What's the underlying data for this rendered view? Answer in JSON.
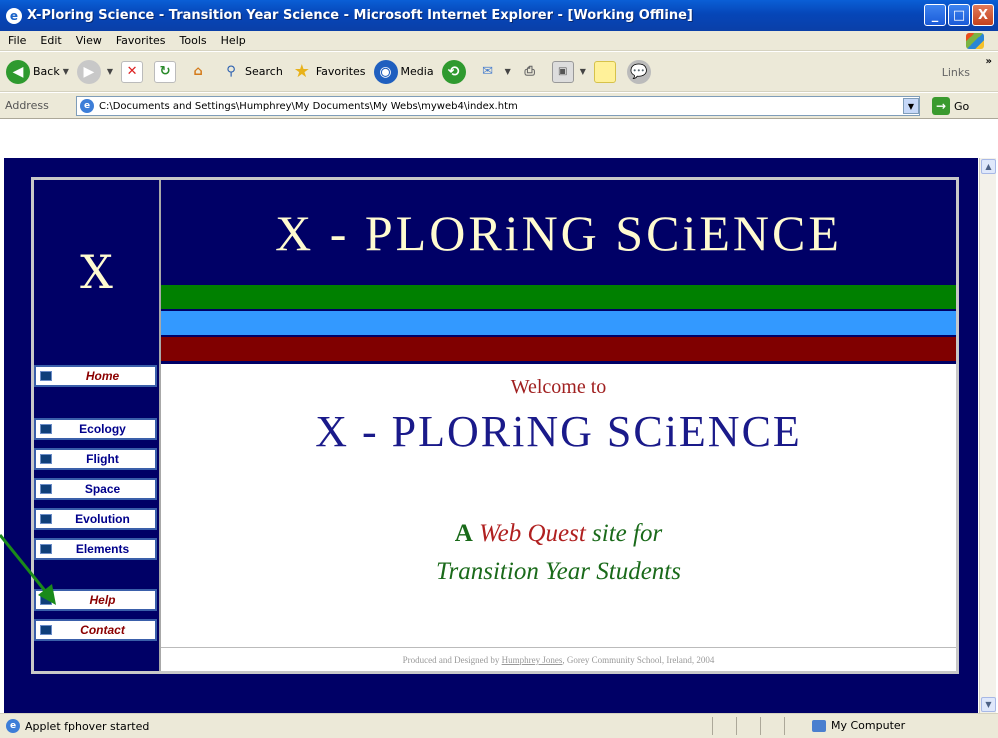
{
  "window": {
    "title": "X-Ploring Science - Transition Year Science - Microsoft Internet Explorer - [Working Offline]",
    "minimize": "_",
    "maximize": "□",
    "close": "X"
  },
  "menu": [
    "File",
    "Edit",
    "View",
    "Favorites",
    "Tools",
    "Help"
  ],
  "toolbar": {
    "back": "Back",
    "search": "Search",
    "favorites": "Favorites",
    "media": "Media",
    "links": "Links",
    "overflow": "»",
    "icons": [
      "back-icon",
      "forward-icon",
      "stop-icon",
      "refresh-icon",
      "home-icon",
      "search-icon",
      "favorites-icon",
      "media-icon",
      "history-icon",
      "mail-icon",
      "print-icon",
      "edit-icon",
      "notes-icon",
      "messenger-icon"
    ]
  },
  "address": {
    "label": "Address",
    "url": "C:\\Documents and Settings\\Humphrey\\My Documents\\My Webs\\myweb4\\index.htm",
    "go": "Go"
  },
  "site": {
    "logo_letter": "X",
    "banner": "X - PLORiNG SCiENCE",
    "nav": [
      {
        "label": "Home",
        "style": "red"
      },
      {
        "label": "Ecology",
        "style": "blue"
      },
      {
        "label": "Flight",
        "style": "blue"
      },
      {
        "label": "Space",
        "style": "blue"
      },
      {
        "label": "Evolution",
        "style": "blue"
      },
      {
        "label": "Elements",
        "style": "blue"
      },
      {
        "label": "Help",
        "style": "red"
      },
      {
        "label": "Contact",
        "style": "red"
      }
    ],
    "welcome": "Welcome to",
    "title": "X - PLORiNG SCiENCE",
    "tagline_a": "A",
    "tagline_webquest": "Web Quest",
    "tagline_site_for": "site for",
    "tagline_line2": "Transition Year Students",
    "footer_prefix": "Produced and Designed by",
    "footer_name": "Humphrey Jones",
    "footer_suffix": ", Gorey Community School, Ireland, 2004",
    "colors": {
      "page_bg": "#000066",
      "stripe_green": "#008000",
      "stripe_blue": "#3399ff",
      "stripe_maroon": "#800000",
      "banner_text": "#fffbd0"
    }
  },
  "status": {
    "text": "Applet fphover started",
    "zone": "My Computer"
  }
}
